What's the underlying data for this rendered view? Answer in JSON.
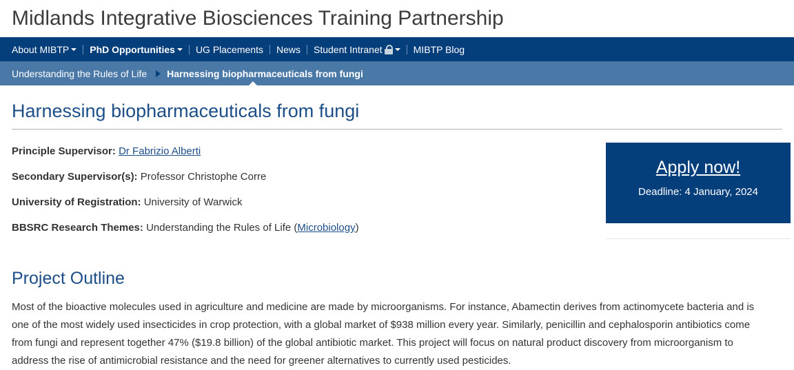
{
  "site": {
    "title": "Midlands Integrative Biosciences Training Partnership"
  },
  "nav": {
    "items": [
      {
        "label": "About MIBTP",
        "dropdown": true
      },
      {
        "label": "PhD Opportunities",
        "dropdown": true,
        "active": true
      },
      {
        "label": "UG Placements"
      },
      {
        "label": "News"
      },
      {
        "label": "Student Intranet",
        "dropdown": true,
        "icon": "lock-icon"
      },
      {
        "label": "MIBTP Blog"
      }
    ]
  },
  "subnav": {
    "parent": "Understanding the Rules of Life",
    "current": "Harnessing biopharmaceuticals from fungi"
  },
  "page": {
    "title": "Harnessing biopharmaceuticals from fungi"
  },
  "details": {
    "principal_label": "Principle Supervisor:",
    "principal_value": "Dr Fabrizio Alberti",
    "secondary_label": "Secondary Supervisor(s):",
    "secondary_value": "Professor Christophe Corre",
    "university_label": "University of Registration:",
    "university_value": "University of Warwick",
    "themes_label": "BBSRC Research Themes:",
    "themes_value": "Understanding the Rules of Life (",
    "themes_link": "Microbiology",
    "themes_close": ")"
  },
  "apply": {
    "link": "Apply now!",
    "deadline": "Deadline: 4 January, 2024"
  },
  "outline": {
    "title": "Project Outline",
    "text": "Most of the bioactive molecules used in agriculture and medicine are made by microorganisms. For instance, Abamectin derives from actinomycete bacteria and is one of the most widely used insecticides in crop protection, with a global market of $938 million every year. Similarly, penicillin and cephalosporin antibiotics come from fungi and represent together 47% ($19.8 billion) of the global antibiotic market. This project will focus on natural product discovery from microorganism to address the rise of antimicrobial resistance and the need for greener alternatives to currently used pesticides."
  },
  "colors": {
    "nav_bg": "#043e7b",
    "subnav_bg": "#4a79a7",
    "heading": "#1d4e87"
  }
}
